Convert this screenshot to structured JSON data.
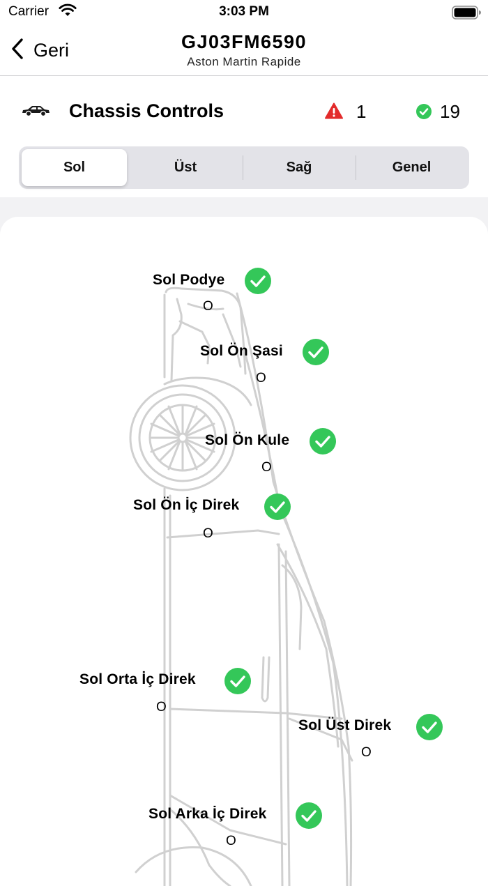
{
  "status_bar": {
    "carrier": "Carrier",
    "time": "3:03 PM"
  },
  "nav": {
    "back_label": "Geri",
    "title": "GJ03FM6590",
    "subtitle": "Aston Martin Rapide"
  },
  "header": {
    "title": "Chassis Controls",
    "warning_count": "1",
    "ok_count": "19",
    "warning_color": "#e32b2b",
    "ok_color": "#34c759"
  },
  "tabs": [
    {
      "label": "Sol",
      "selected": true
    },
    {
      "label": "Üst",
      "selected": false
    },
    {
      "label": "Sağ",
      "selected": false
    },
    {
      "label": "Genel",
      "selected": false
    }
  ],
  "points": [
    {
      "label": "Sol Podye",
      "value": "O",
      "status": "check-icon"
    },
    {
      "label": "Sol Ön Şasi",
      "value": "O",
      "status": "check-icon"
    },
    {
      "label": "Sol Ön Kule",
      "value": "O",
      "status": "check-icon"
    },
    {
      "label": "Sol Ön İç Direk",
      "value": "O",
      "status": "check-icon"
    },
    {
      "label": "Sol Orta İç Direk",
      "value": "O",
      "status": "check-icon"
    },
    {
      "label": "Sol Üst Direk",
      "value": "O",
      "status": "check-icon"
    },
    {
      "label": "Sol Arka İç Direk",
      "value": "O",
      "status": "check-icon"
    }
  ]
}
